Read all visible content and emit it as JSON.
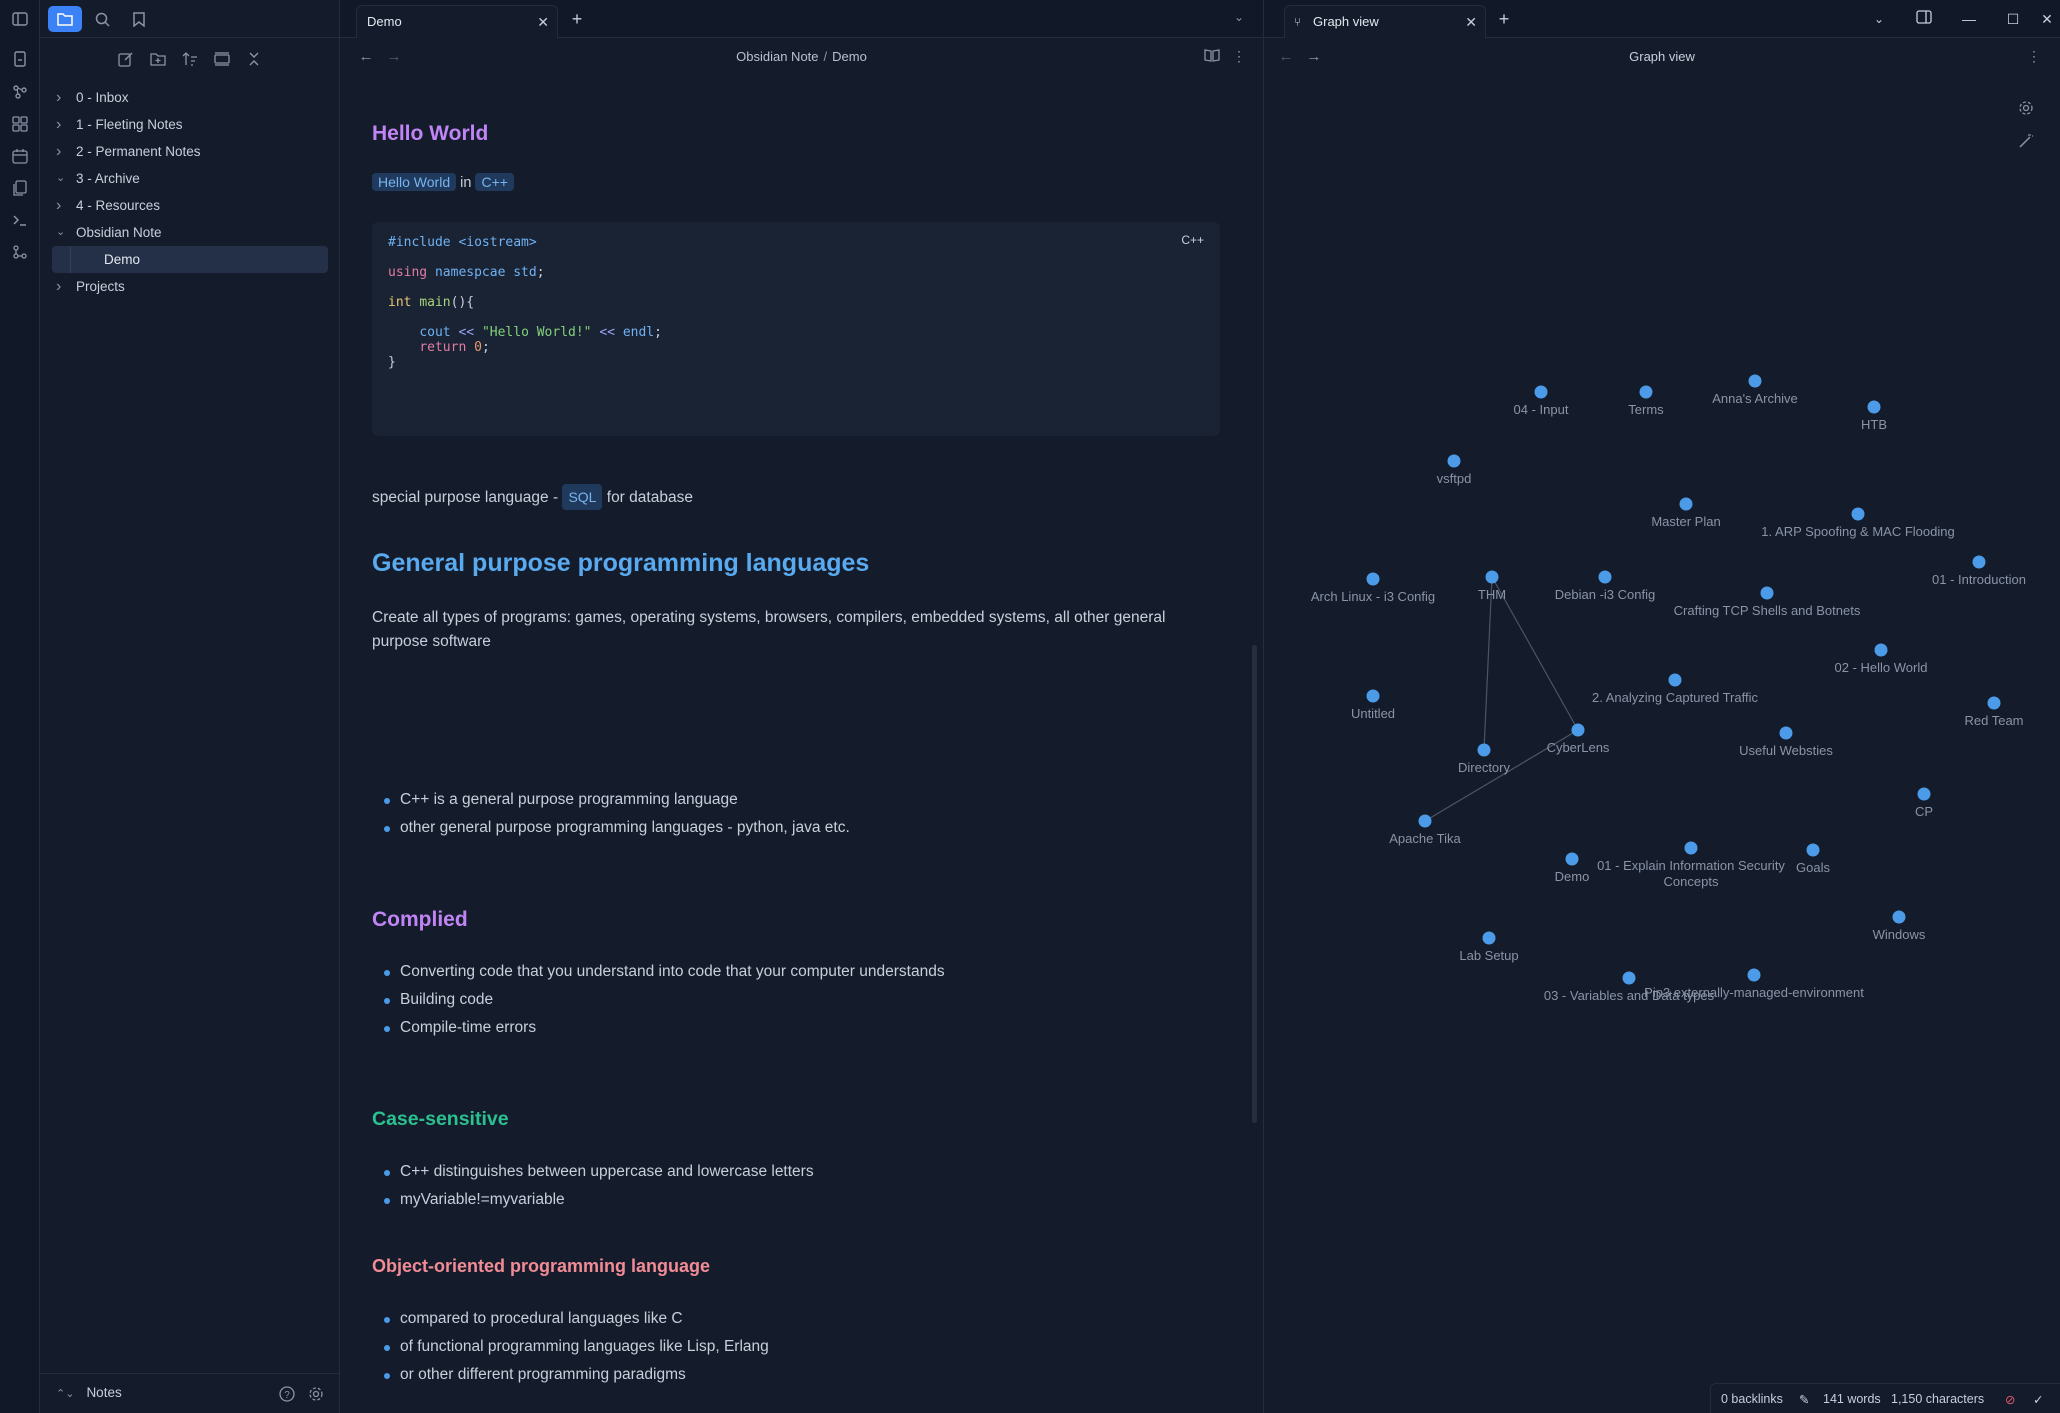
{
  "sidebar": {
    "folders": [
      {
        "label": "0 - Inbox",
        "expanded": false
      },
      {
        "label": "1 - Fleeting Notes",
        "expanded": false
      },
      {
        "label": "2 - Permanent Notes",
        "expanded": false
      },
      {
        "label": "3 - Archive",
        "expanded": true
      },
      {
        "label": "4 - Resources",
        "expanded": false
      },
      {
        "label": "Obsidian Note",
        "expanded": true
      },
      {
        "label": "Demo",
        "child": true,
        "active": true
      },
      {
        "label": "Projects",
        "expanded": false
      }
    ],
    "vault_name": "Notes"
  },
  "editor": {
    "tab_title": "Demo",
    "breadcrumb": [
      "Obsidian Note",
      "Demo"
    ],
    "heading_hello": "Hello World",
    "tag1": "Hello World",
    "tag_in": "in",
    "tag2": "C++",
    "code_lang": "C++",
    "code_lines": [
      {
        "parts": [
          [
            "pp",
            "#include <iostream>"
          ]
        ]
      },
      {
        "parts": [
          [
            "kw",
            "using"
          ],
          [
            "",
            " "
          ],
          [
            "ns",
            "namespcae std"
          ],
          [
            "",
            ";"
          ]
        ]
      },
      {
        "parts": [
          [
            "ty",
            "int"
          ],
          [
            "",
            " "
          ],
          [
            "fn",
            "main"
          ],
          [
            "",
            "(){"
          ]
        ]
      },
      {
        "parts": [
          [
            "",
            "    "
          ],
          [
            "ns",
            "cout"
          ],
          [
            "",
            " "
          ],
          [
            "op",
            "<<"
          ],
          [
            "",
            " "
          ],
          [
            "str",
            "\"Hello World!\""
          ],
          [
            "",
            " "
          ],
          [
            "op",
            "<<"
          ],
          [
            "",
            " "
          ],
          [
            "ns",
            "endl"
          ],
          [
            "",
            ";"
          ]
        ]
      },
      {
        "parts": [
          [
            "",
            "    "
          ],
          [
            "kw",
            "return"
          ],
          [
            "",
            " "
          ],
          [
            "num",
            "0"
          ],
          [
            "",
            ";"
          ]
        ]
      },
      {
        "parts": [
          [
            "",
            "}"
          ]
        ]
      }
    ],
    "special_text_before": "special purpose language - ",
    "special_tag": "SQL",
    "special_text_after": " for database",
    "h_general": "General purpose programming languages",
    "general_para": "Create all types of programs: games, operating systems, browsers, compilers, embedded systems, all other general purpose software",
    "general_items": [
      "C++ is a general purpose programming language",
      "other general purpose programming languages - python, java etc."
    ],
    "h_complied": "Complied",
    "complied_items": [
      "Converting code that you understand into code that your computer understands",
      "Building code",
      "Compile-time errors"
    ],
    "h_case": "Case-sensitive",
    "case_items": [
      "C++ distinguishes between uppercase and lowercase letters",
      "myVariable!=myvariable"
    ],
    "h_oop": "Object-oriented programming language",
    "oop_items": [
      "compared to procedural languages like C",
      "of functional programming languages like Lisp, Erlang",
      "or other different programming paradigms"
    ]
  },
  "graph": {
    "tab_title": "Graph view",
    "title": "Graph view",
    "nodes": [
      {
        "label": "04 - Input"
      },
      {
        "label": "Terms"
      },
      {
        "label": "Anna's Archive"
      },
      {
        "label": "HTB"
      },
      {
        "label": "vsftpd"
      },
      {
        "label": "Master Plan"
      },
      {
        "label": "1. ARP Spoofing & MAC Flooding"
      },
      {
        "label": "01 - Introduction"
      },
      {
        "label": "Arch Linux - i3 Config"
      },
      {
        "label": "THM"
      },
      {
        "label": "Debian -i3 Config"
      },
      {
        "label": "Crafting TCP Shells and Botnets"
      },
      {
        "label": "02 - Hello World"
      },
      {
        "label": "Untitled"
      },
      {
        "label": "2. Analyzing Captured Traffic"
      },
      {
        "label": "Red Team"
      },
      {
        "label": "CyberLens"
      },
      {
        "label": "Directory"
      },
      {
        "label": "Useful Websties"
      },
      {
        "label": "CP"
      },
      {
        "label": "Apache Tika"
      },
      {
        "label": "Demo"
      },
      {
        "label": "01 - Explain Information Security Concepts"
      },
      {
        "label": "Goals"
      },
      {
        "label": "Windows"
      },
      {
        "label": "Lab Setup"
      },
      {
        "label": "03 - Variables and Data types"
      },
      {
        "label": "Pip3 externally-managed-environment"
      }
    ],
    "edges": [
      [
        "THM",
        "Directory"
      ],
      [
        "THM",
        "CyberLens"
      ],
      [
        "CyberLens",
        "Apache Tika"
      ]
    ]
  },
  "status": {
    "backlinks": "0 backlinks",
    "words": "141 words",
    "characters": "1,150 characters"
  },
  "colors": {
    "accent": "#3b82f6",
    "node": "#4b9be8",
    "h_purple": "#c184f5",
    "h_blue": "#5aaaf0",
    "h_green": "#2bc08f",
    "h_pink": "#f28b95"
  }
}
